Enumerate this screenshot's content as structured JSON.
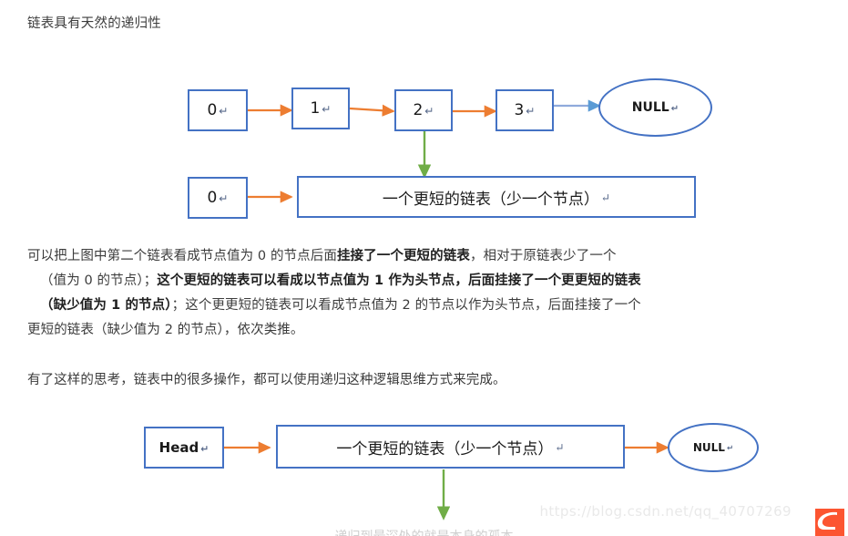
{
  "page": {
    "title": "链表具有天然的递归性",
    "background": "#ffffff"
  },
  "colors": {
    "node_border": "#4472C4",
    "arrow_orange": "#ED7D31",
    "arrow_green": "#70AD47",
    "arrow_light_blue": "#8FAADC",
    "text": "#3c3c3c",
    "watermark": "#e9e9e9",
    "csdn_orange": "#FC5531"
  },
  "diagram_top": {
    "nodes": [
      {
        "label": "0",
        "return_mark": "↵"
      },
      {
        "label": "1",
        "return_mark": "↵"
      },
      {
        "label": "2",
        "return_mark": "↵"
      },
      {
        "label": "3",
        "return_mark": "↵"
      }
    ],
    "terminator": {
      "label": "NULL",
      "return_mark": "↵"
    },
    "second_row": {
      "head": {
        "label": "0",
        "return_mark": "↵"
      },
      "body": {
        "label": "一个更短的链表（少一个节点）",
        "return_mark": "↵"
      }
    }
  },
  "paragraph_one": {
    "line1_a": "可以把上图中第二个链表看成节点值为 0 的节点后面",
    "line1_b": "挂接了一个更短的链表",
    "line1_c": "，相对于原链表少了一个",
    "line2_a": "（值为 0 的节点）；",
    "line2_b": "这个更短的链表可以看成以节点值为 1 作为头节点，后面挂接了一个更更短的链表",
    "line3_a": "（缺少值为 1 的节点）",
    "line3_b": "；这个更更短的链表可以看成节点值为 2 的节点以作为头节点，后面挂接了一个",
    "line4": "更短的链表（缺少值为 2 的节点），依次类推。"
  },
  "paragraph_two": {
    "text": "有了这样的思考，链表中的很多操作，都可以使用递归这种逻辑思维方式来完成。"
  },
  "diagram_bottom": {
    "head": {
      "label": "Head",
      "return_mark": "↵"
    },
    "body": {
      "label": "一个更短的链表（少一个节点）",
      "return_mark": "↵"
    },
    "terminator": {
      "label": "NULL",
      "return_mark": "↵"
    },
    "cut_off_caption": "递归到最深处的就是本身的孤本"
  },
  "watermark": {
    "url": "https://blog.csdn.net/qq_40707269",
    "logo_name": "csdn-logo"
  }
}
